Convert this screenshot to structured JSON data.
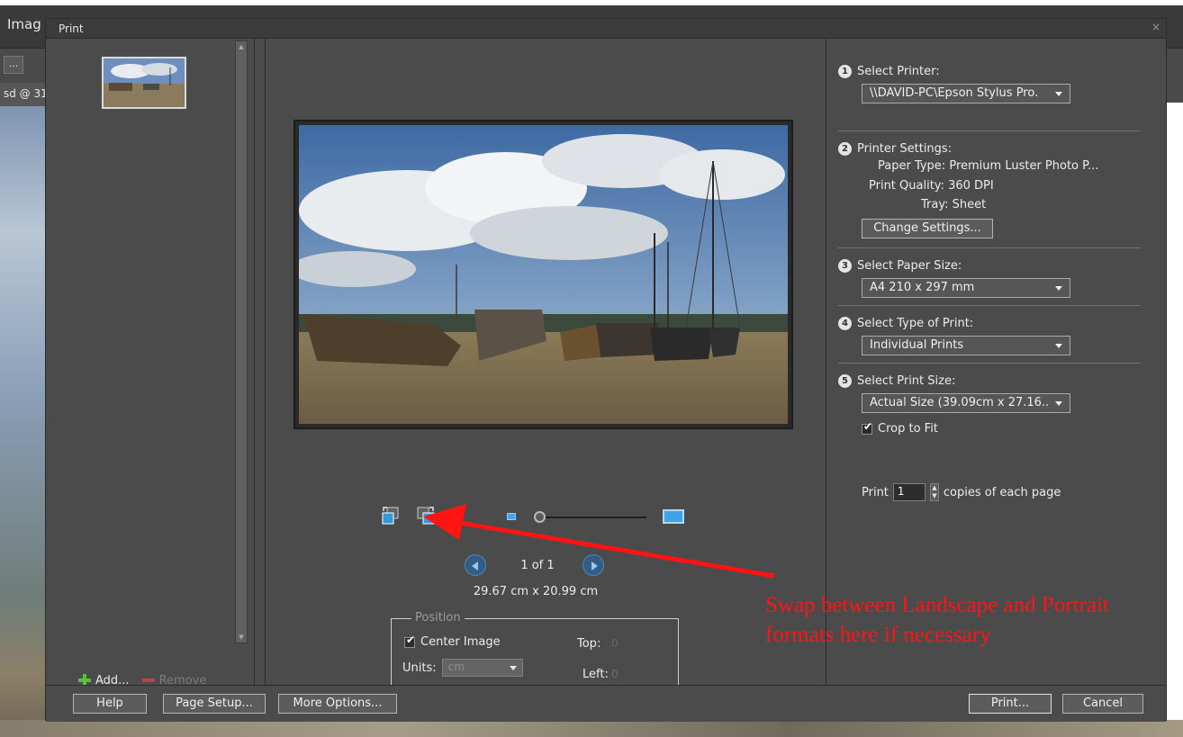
{
  "background_app": {
    "title_fragment": "Imag",
    "button_fragment": "...",
    "document_tab_fragment": "sd @ 31"
  },
  "dialog": {
    "title": "Print",
    "close_glyph": "×"
  },
  "thumbnails": {
    "add_label": "Add...",
    "remove_label": "Remove"
  },
  "preview": {
    "page_indicator": "1 of 1",
    "print_size": "29.67 cm x 20.99 cm",
    "position": {
      "legend": "Position",
      "center_image_label": "Center Image",
      "center_image_checked": true,
      "units_label": "Units:",
      "units_value": "cm",
      "top_label": "Top:",
      "top_value": "0",
      "left_label": "Left:",
      "left_value": "0"
    }
  },
  "settings": {
    "step1": {
      "number": "1",
      "title": "Select Printer:",
      "printer": "\\\\DAVID-PC\\Epson Stylus Pro."
    },
    "step2": {
      "number": "2",
      "title": "Printer Settings:",
      "paper_type_label": "Paper Type:",
      "paper_type_value": "Premium Luster Photo P...",
      "print_quality_label": "Print Quality:",
      "print_quality_value": "360 DPI",
      "tray_label": "Tray:",
      "tray_value": "Sheet",
      "change_settings_label": "Change Settings..."
    },
    "step3": {
      "number": "3",
      "title": "Select Paper Size:",
      "value": "A4 210 x 297 mm"
    },
    "step4": {
      "number": "4",
      "title": "Select Type of Print:",
      "value": "Individual Prints"
    },
    "step5": {
      "number": "5",
      "title": "Select Print Size:",
      "value": "Actual Size (39.09cm x 27.16..",
      "crop_to_fit_label": "Crop to Fit",
      "crop_to_fit_checked": true
    },
    "copies": {
      "prefix": "Print",
      "value": "1",
      "suffix": "copies of each page"
    }
  },
  "footer": {
    "help_label": "Help",
    "page_setup_label": "Page Setup...",
    "more_options_label": "More Options...",
    "print_label": "Print...",
    "cancel_label": "Cancel"
  },
  "annotation": {
    "text": "Swap between Landscape and Portrait formats here if necessary",
    "color": "#ff1414"
  },
  "icons": {
    "rotate_left": "rotate-left-icon",
    "rotate_right": "rotate-right-icon",
    "zoom_small": "zoom-small-icon",
    "zoom_large": "zoom-large-icon",
    "prev": "previous-page-icon",
    "next": "next-page-icon",
    "add": "plus-icon",
    "remove": "minus-icon"
  }
}
